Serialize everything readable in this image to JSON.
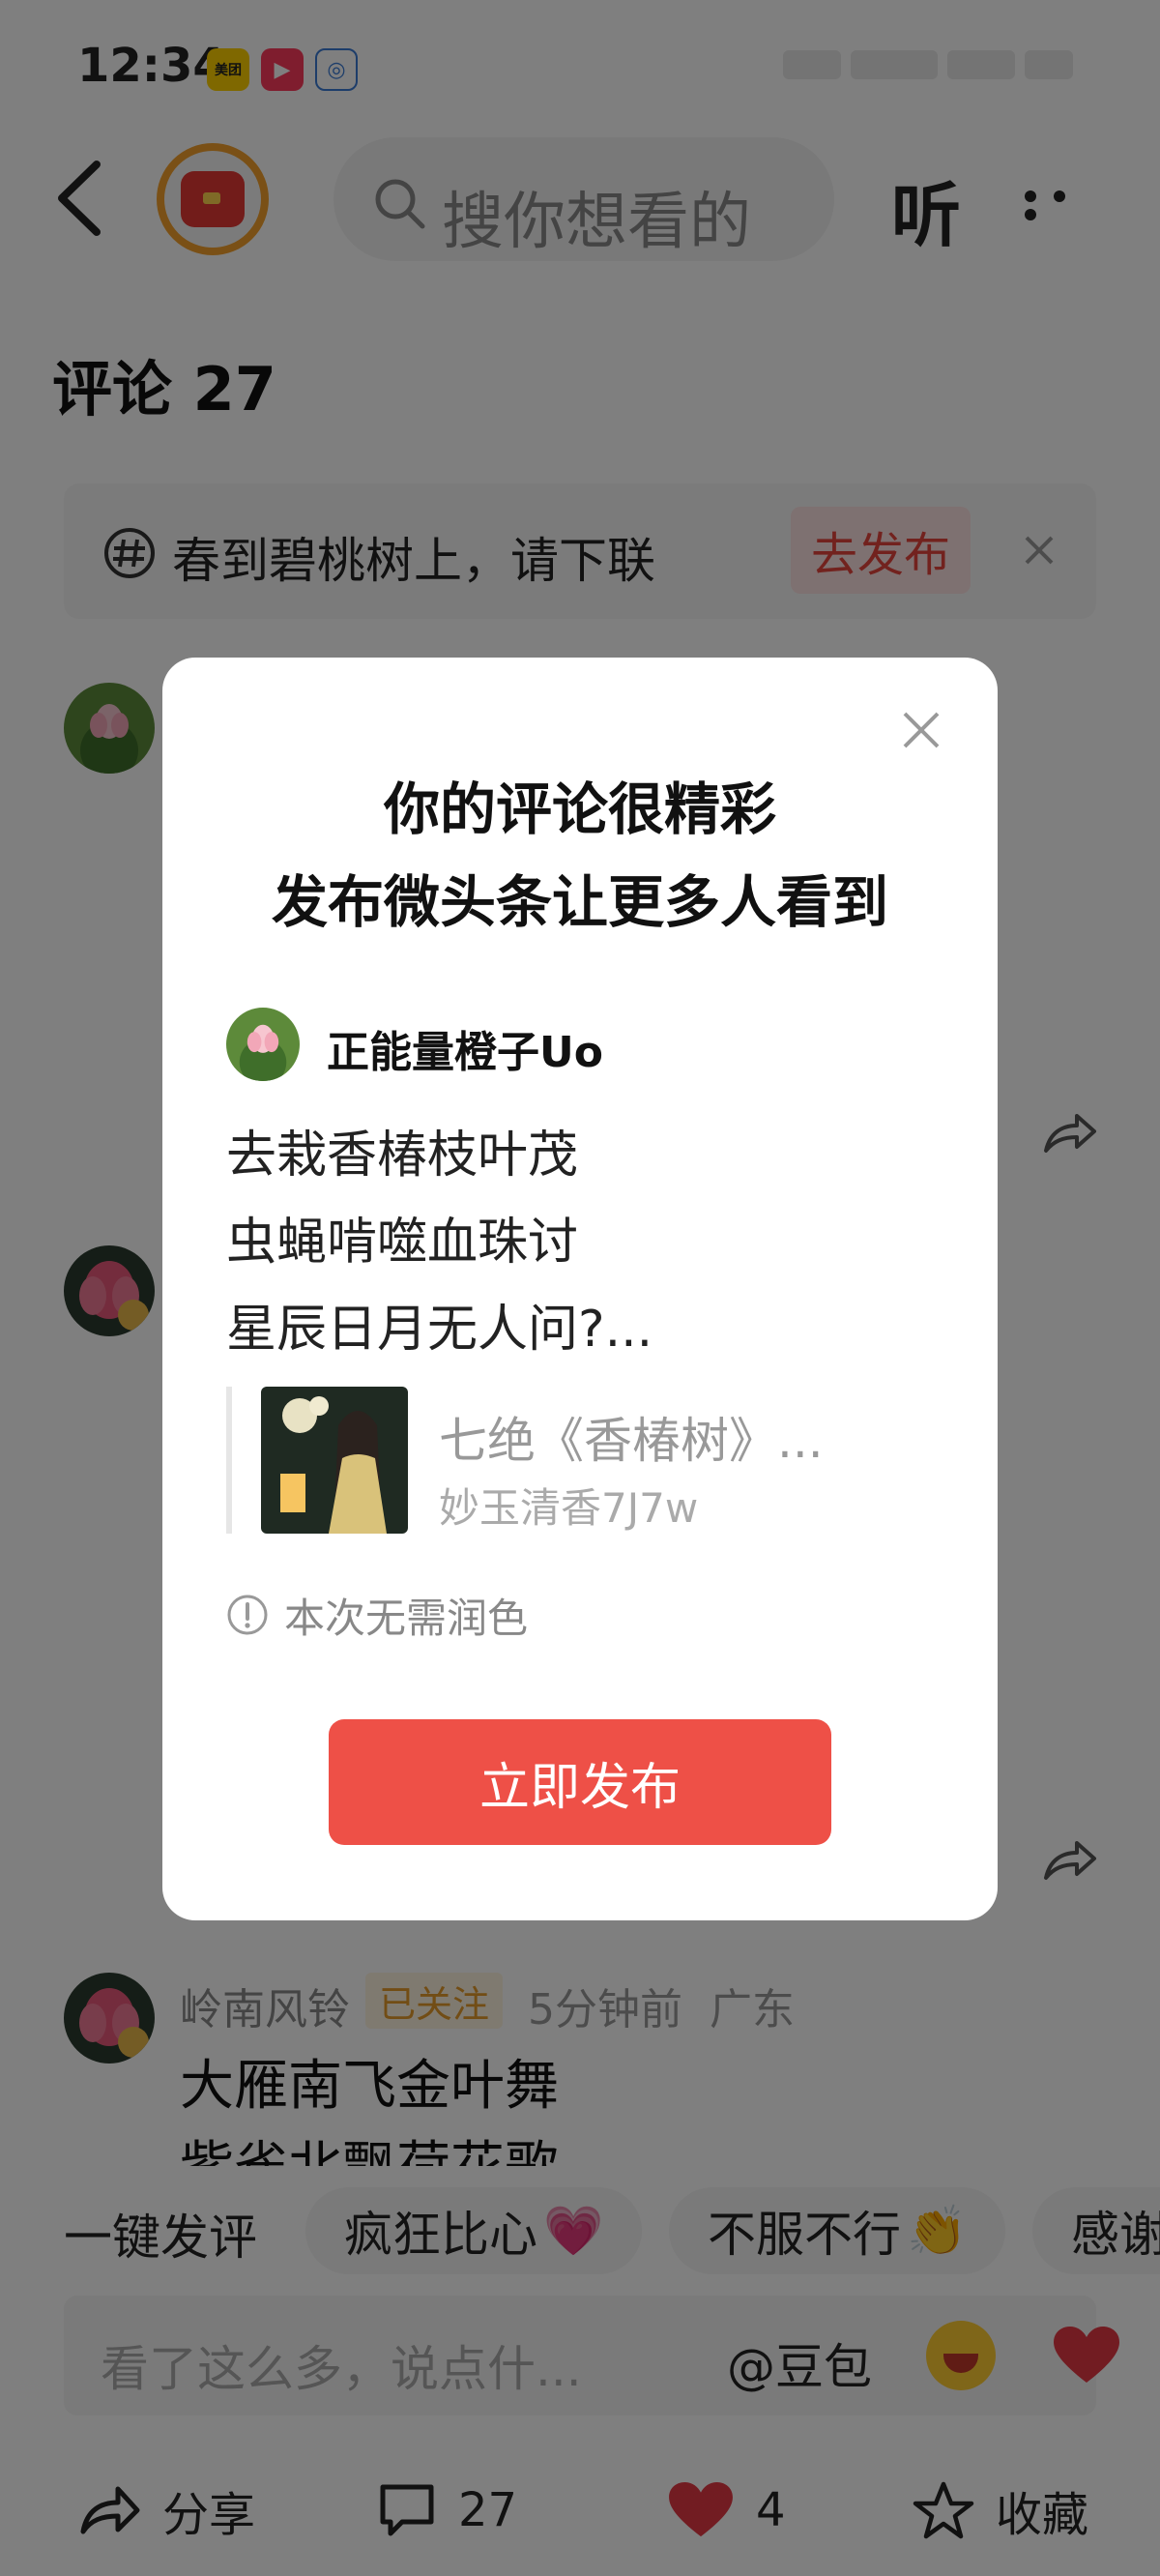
{
  "status_bar": {
    "time": "12:34",
    "apps": [
      {
        "icon": "meituan-icon",
        "label": "美团"
      },
      {
        "icon": "video-play-icon",
        "label": ""
      },
      {
        "icon": "chat-bubble-icon",
        "label": ""
      }
    ]
  },
  "header": {
    "back_icon": "back-arrow-icon",
    "avatar_icon": "red-bag-avatar-icon",
    "search_placeholder": "搜你想看的",
    "listen_label": "听",
    "more_icon": "more-dots-icon"
  },
  "comments": {
    "title": "评论 27",
    "topic": {
      "icon": "hashtag-icon",
      "text": "春到碧桃树上，请下联",
      "action": "去发布"
    },
    "third_comment": {
      "author": "岭南风铃",
      "follow_badge": "已关注",
      "time": "5分钟前",
      "location": "广东",
      "line1": "大雁南飞金叶舞",
      "line2": "紫雀北飘荷花歌"
    }
  },
  "quick_reply": {
    "label": "一键发评",
    "chips": [
      {
        "text": "疯狂比心",
        "emoji": "💗"
      },
      {
        "text": "不服不行",
        "emoji": "👏"
      },
      {
        "text": "感谢",
        "emoji": ""
      }
    ]
  },
  "comment_input": {
    "placeholder": "看了这么多，说点什...",
    "at_label": "@豆包"
  },
  "bottom_bar": {
    "share_label": "分享",
    "comment_count": "27",
    "like_count": "4",
    "favorite_label": "收藏"
  },
  "dialog": {
    "title_line1": "你的评论很精彩",
    "title_line2": "发布微头条让更多人看到",
    "author": "正能量橙子Uo",
    "poem_lines": [
      "去栽香椿枝叶茂",
      "虫蝇啃噬血珠讨",
      "星辰日月无人问?..."
    ],
    "quote_title": "七绝《香椿树》...",
    "quote_author": "妙玉清香7J7w",
    "notice": "本次无需润色",
    "publish_label": "立即发布"
  },
  "colors": {
    "accent_red": "#ee5047",
    "follow_orange": "#e59a2a",
    "avatar_ring": "#f4a12c"
  }
}
